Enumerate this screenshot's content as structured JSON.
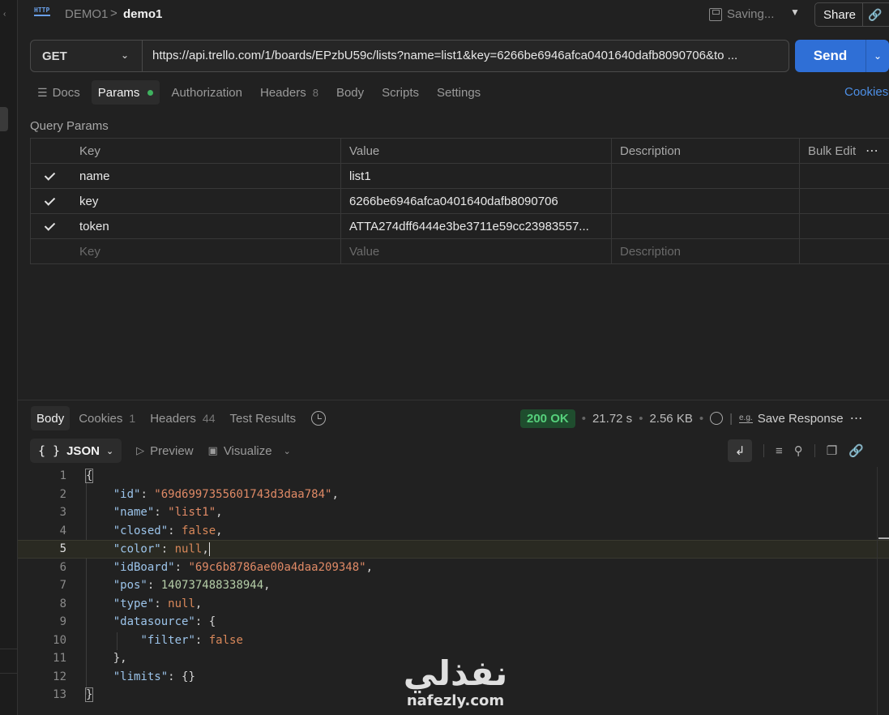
{
  "breadcrumb": {
    "parent": "DEMO1",
    "separator": ">",
    "current": "demo1"
  },
  "header": {
    "saving_label": "Saving...",
    "share_label": "Share"
  },
  "request": {
    "method": "GET",
    "url": "https://api.trello.com/1/boards/EPzbU59c/lists?name=list1&key=6266be6946afca0401640dafb8090706&to ...",
    "send_label": "Send"
  },
  "request_tabs": [
    {
      "label": "Docs"
    },
    {
      "label": "Params"
    },
    {
      "label": "Authorization"
    },
    {
      "label": "Headers",
      "badge": "8"
    },
    {
      "label": "Body"
    },
    {
      "label": "Scripts"
    },
    {
      "label": "Settings"
    }
  ],
  "cookies_link": "Cookies",
  "query_params": {
    "title": "Query Params",
    "columns": {
      "key": "Key",
      "value": "Value",
      "description": "Description",
      "bulk_edit": "Bulk Edit"
    },
    "rows": [
      {
        "key": "name",
        "value": "list1",
        "description": ""
      },
      {
        "key": "key",
        "value": "6266be6946afca0401640dafb8090706",
        "description": ""
      },
      {
        "key": "token",
        "value": "ATTA274dff6444e3be3711e59cc23983557...",
        "description": ""
      }
    ],
    "placeholder": {
      "key": "Key",
      "value": "Value",
      "description": "Description"
    }
  },
  "response_tabs": [
    {
      "label": "Body"
    },
    {
      "label": "Cookies",
      "badge": "1"
    },
    {
      "label": "Headers",
      "badge": "44"
    },
    {
      "label": "Test Results"
    }
  ],
  "response_status": {
    "status": "200 OK",
    "time": "21.72 s",
    "size": "2.56 KB",
    "save_label": "Save Response",
    "save_icon_text": "e.g."
  },
  "response_tools": {
    "format": "JSON",
    "preview": "Preview",
    "visualize": "Visualize"
  },
  "code_lines": [
    "1",
    "2",
    "3",
    "4",
    "5",
    "6",
    "7",
    "8",
    "9",
    "10",
    "11",
    "12",
    "13"
  ],
  "json_body": {
    "id_key": "\"id\"",
    "id_val": "\"69d6997355601743d3daa784\"",
    "name_key": "\"name\"",
    "name_val": "\"list1\"",
    "closed_key": "\"closed\"",
    "closed_val": "false",
    "color_key": "\"color\"",
    "color_val": "null",
    "idBoard_key": "\"idBoard\"",
    "idBoard_val": "\"69c6b8786ae00a4daa209348\"",
    "pos_key": "\"pos\"",
    "pos_val": "140737488338944",
    "type_key": "\"type\"",
    "type_val": "null",
    "datasource_key": "\"datasource\"",
    "filter_key": "\"filter\"",
    "filter_val": "false",
    "limits_key": "\"limits\"",
    "limits_val": "{}"
  },
  "watermark": {
    "arabic": "نفذلي",
    "latin": "nafezly.com"
  },
  "colors": {
    "accent": "#2f6fd6",
    "status_ok": "#56d17c",
    "link": "#4d8fe6"
  }
}
